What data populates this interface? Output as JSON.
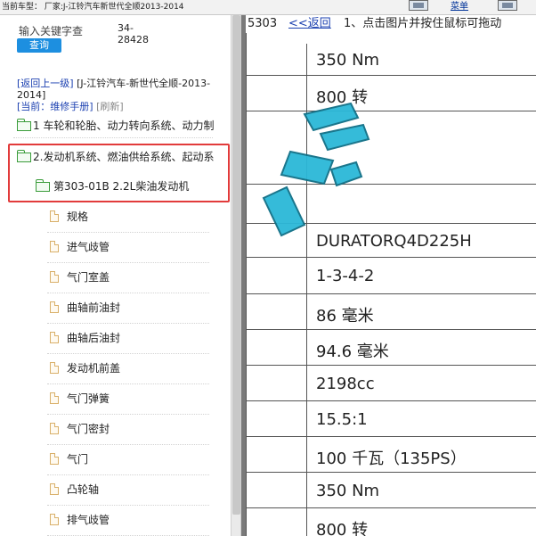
{
  "topbar": {
    "vehicle_text": "当前车型：  厂家:J-江铃汽车新世代全顺2013-2014",
    "menu_label": "菜单"
  },
  "sidebar": {
    "search_label": "输入关键字查",
    "counter": "34-28428",
    "query_button": "查询",
    "back_link": "[返回上一级]",
    "model_path": "[J-江铃汽车-新世代全顺-2013-2014]",
    "current_prefix": "[当前：",
    "current_value": "维修手册",
    "current_suffix": "]",
    "refresh": "[刷新]",
    "categories": [
      {
        "label": "1 车轮和轮胎、动力转向系统、动力制"
      },
      {
        "label": "2.发动机系统、燃油供给系统、起动系"
      }
    ],
    "subcategory": {
      "label": "第303-01B 2.2L柴油发动机"
    },
    "leaf_items": [
      {
        "label": "规格"
      },
      {
        "label": "进气歧管"
      },
      {
        "label": "气门室盖"
      },
      {
        "label": "曲轴前油封"
      },
      {
        "label": "曲轴后油封"
      },
      {
        "label": "发动机前盖"
      },
      {
        "label": "气门弹簧"
      },
      {
        "label": "气门密封"
      },
      {
        "label": "气门"
      },
      {
        "label": "凸轮轴"
      },
      {
        "label": "排气歧管"
      }
    ]
  },
  "content": {
    "doc_code": "5303",
    "back_link": "<<返回",
    "hint": "1、点击图片并按住鼠标可拖动",
    "rows": [
      {
        "value": "350 Nm"
      },
      {
        "value": "800 转"
      },
      {
        "value": ""
      },
      {
        "value": ""
      },
      {
        "value": "DURATORQ4D225H"
      },
      {
        "value": "1-3-4-2"
      },
      {
        "value": "86 毫米"
      },
      {
        "value": "94.6 毫米"
      },
      {
        "value": "2198cc"
      },
      {
        "value": "15.5:1"
      },
      {
        "value": "100 千瓦（135PS）"
      },
      {
        "value": "350 Nm"
      },
      {
        "value": "800 转"
      }
    ]
  },
  "colors": {
    "accent": "#1d8fe0",
    "highlight_border": "#e23b3b",
    "link": "#1a3fb0",
    "folder": "#3a9c3a",
    "watermark": "#2bb8d8"
  }
}
